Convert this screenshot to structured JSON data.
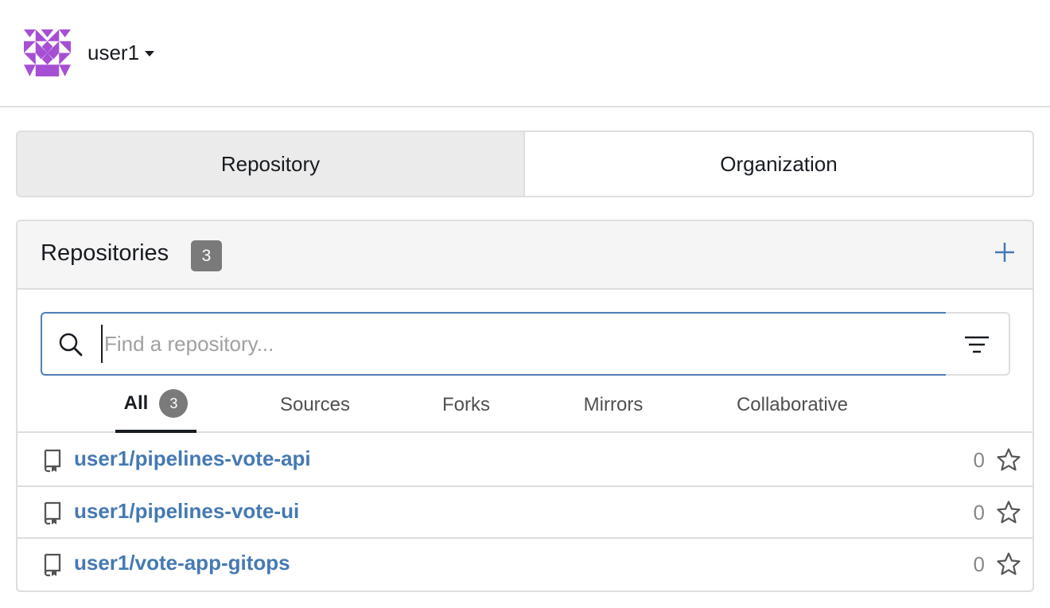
{
  "header": {
    "user_name": "user1"
  },
  "type_tabs": [
    {
      "label": "Repository",
      "active": true
    },
    {
      "label": "Organization",
      "active": false
    }
  ],
  "panel": {
    "title": "Repositories",
    "count": "3"
  },
  "search": {
    "value": "",
    "placeholder": "Find a repository..."
  },
  "filter_tabs": [
    {
      "label": "All",
      "badge": "3",
      "active": true
    },
    {
      "label": "Sources"
    },
    {
      "label": "Forks"
    },
    {
      "label": "Mirrors"
    },
    {
      "label": "Collaborative"
    }
  ],
  "repos": [
    {
      "name": "user1/pipelines-vote-api",
      "stars": "0"
    },
    {
      "name": "user1/pipelines-vote-ui",
      "stars": "0"
    },
    {
      "name": "user1/vote-app-gitops",
      "stars": "0"
    }
  ],
  "colors": {
    "accent": "#4579b3",
    "avatar": "#a64fd4",
    "badge": "#7a7a7a"
  },
  "icons": {
    "avatar": "identicon-avatar",
    "add": "plus-icon",
    "search": "search-icon",
    "filter": "filter-icon",
    "repo": "repo-book-icon",
    "star": "star-icon"
  }
}
